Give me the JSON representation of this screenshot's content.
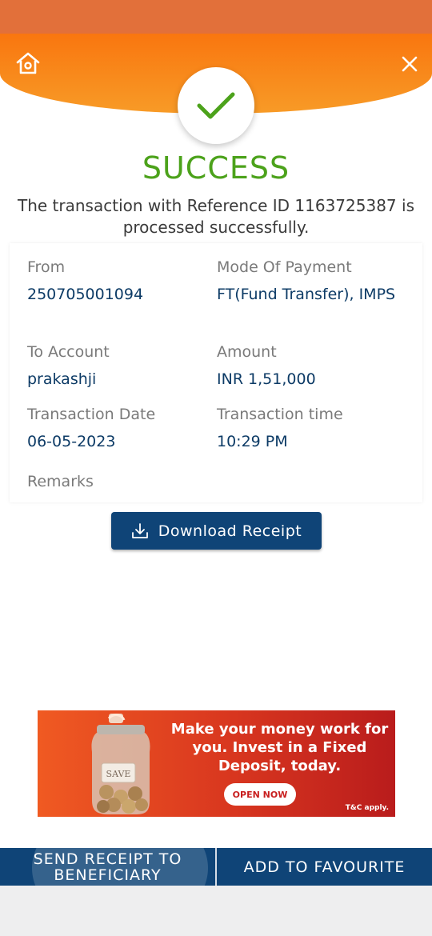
{
  "header": {
    "home_icon": "home-icon",
    "close_icon": "close-icon"
  },
  "status": {
    "icon": "checkmark-icon",
    "title": "SUCCESS",
    "message": "The transaction with Reference ID 1163725387 is processed successfully.",
    "accent": "#4ca21b"
  },
  "details": [
    {
      "label": "From",
      "value": "250705001094"
    },
    {
      "label": "Mode Of Payment",
      "value": "FT(Fund Transfer), IMPS"
    },
    {
      "label": "To Account",
      "value": "prakashji"
    },
    {
      "label": "Amount",
      "value": "INR 1,51,000"
    },
    {
      "label": "Transaction Date",
      "value": "06-05-2023"
    },
    {
      "label": "Transaction time",
      "value": "10:29 PM"
    },
    {
      "label": "Remarks",
      "value": ""
    }
  ],
  "download": {
    "label": "Download Receipt",
    "icon": "download-icon"
  },
  "banner": {
    "jar_label": "SAVE",
    "headline": "Make your money work for you. Invest in a Fixed Deposit, today.",
    "cta": "OPEN NOW",
    "tc": "T&C apply."
  },
  "actions": {
    "send_receipt": "SEND RECEIPT TO BENEFICIARY",
    "add_favourite": "ADD TO FAVOURITE"
  },
  "colors": {
    "brand_orange": "#f9760f",
    "navy": "#0f4477"
  }
}
